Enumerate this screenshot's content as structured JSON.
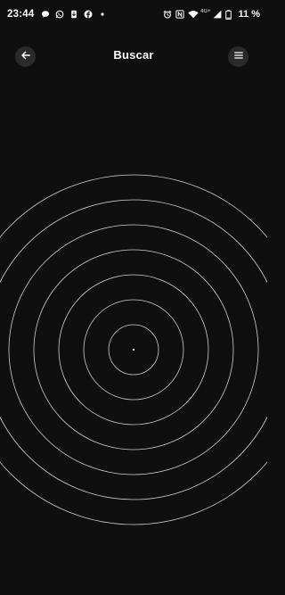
{
  "status_bar": {
    "time": "23:44",
    "left_icons": [
      "chat-bubble-icon",
      "whatsapp-icon",
      "download-icon",
      "facebook-icon",
      "notification-dot-icon"
    ],
    "right_icons": [
      "alarm-icon",
      "nfc-icon",
      "wifi-icon",
      "cell-signal-icon",
      "battery-icon"
    ],
    "network_label": "4G+",
    "battery_text": "11 %"
  },
  "app_bar": {
    "title": "Buscar",
    "back_icon": "arrow-left-icon",
    "menu_icon": "menu-icon"
  },
  "radar": {
    "ring_count": 7,
    "ring_color": "#cfcfcf",
    "center_dot_color": "#cfcfcf"
  },
  "colors": {
    "background": "#0f0f0f",
    "button_background": "#2a2a2a",
    "text": "#ffffff"
  }
}
